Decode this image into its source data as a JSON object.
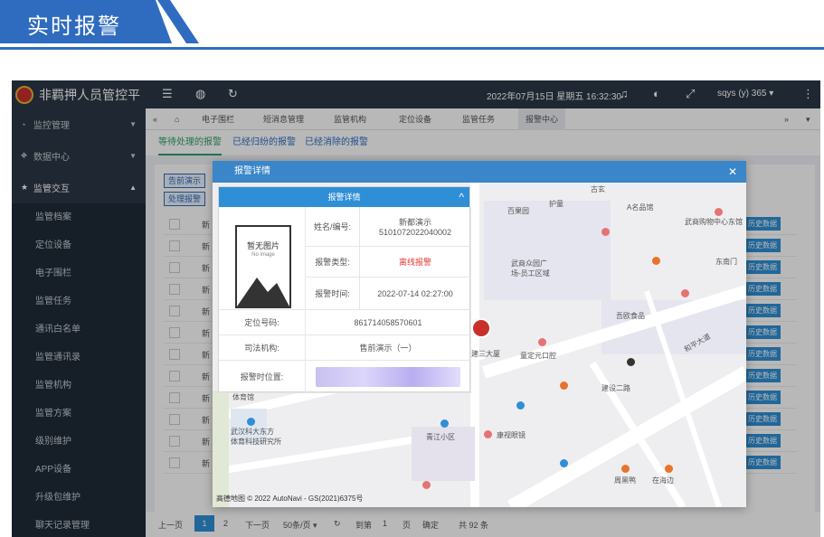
{
  "banner": {
    "title": "实时报警"
  },
  "topbar": {
    "app_name": "非羁押人员管控平",
    "datetime": "2022年07月15日 星期五 16:32:30",
    "user": "sqys (y) 365 ▾"
  },
  "sidebar": {
    "groups": [
      {
        "label": "监控管理",
        "icon": "◔"
      },
      {
        "label": "数据中心",
        "icon": "⛖"
      },
      {
        "label": "监管交互",
        "icon": "★"
      }
    ],
    "sub_items": [
      "监管档案",
      "定位设备",
      "电子围栏",
      "监管任务",
      "通讯白名单",
      "监管通讯录",
      "监管机构",
      "监管方案",
      "级别维护",
      "APP设备",
      "升级包维护",
      "聊天记录管理"
    ]
  },
  "tabs": [
    "电子围栏",
    "短消息管理",
    "监管机构",
    "定位设备",
    "监管任务",
    "报警中心"
  ],
  "subtabs": [
    "等待处理的报警",
    "已经归纷的报警",
    "已经消除的报警"
  ],
  "buttons": {
    "b1": "告前演示",
    "b2": "处理报警"
  },
  "table": {
    "rows": [
      "新",
      "新",
      "新",
      "新",
      "新",
      "新",
      "新",
      "新",
      "新",
      "新",
      "新",
      "新"
    ],
    "history_label": "历史数据"
  },
  "pager": {
    "prev": "上一页",
    "page1": "1",
    "page2": "2",
    "next": "下一页",
    "per_page": "50条/页 ▾",
    "goto_label": "到第",
    "goto_value": "1",
    "page_unit": "页",
    "confirm": "确定",
    "total": "共 92 条"
  },
  "modal": {
    "title": "报警详情",
    "panel_title": "报警详情",
    "photo_text": "暂无图片",
    "photo_sub": "No image",
    "fields": {
      "name_label": "姓名/编号:",
      "name_value": "新都演示",
      "id_value": "5101072022040002",
      "type_label": "报警类型:",
      "type_value": "离线报警",
      "time_label": "报警时间:",
      "time_value": "2022-07-14 02:27:00",
      "loc_label": "定位号码:",
      "loc_value": "861714058570601",
      "org_label": "司法机构:",
      "org_value": "售前演示（一）",
      "pos_label": "报警时位置:"
    },
    "map_labels": [
      "古玄",
      "百果园",
      "护童",
      "A名品馆",
      "武商众园广",
      "场-员工区域",
      "武商购物中心东馆",
      "东南门",
      "吾欧食品",
      "建三大厦",
      "童定元口腔",
      "和平大道",
      "建设二路",
      "武汉科大东方",
      "体育科技研究所",
      "体育馆",
      "青江小区",
      "康视眼镜",
      "周黑鸭",
      "在海边"
    ],
    "attribution": "高德地图 © 2022 AutoNavi - GS(2021)6375号"
  },
  "colors": {
    "primary": "#2f6cc0",
    "sidebar": "#2c3846",
    "header_blue": "#3a86c8",
    "alert_red": "#e53935"
  }
}
